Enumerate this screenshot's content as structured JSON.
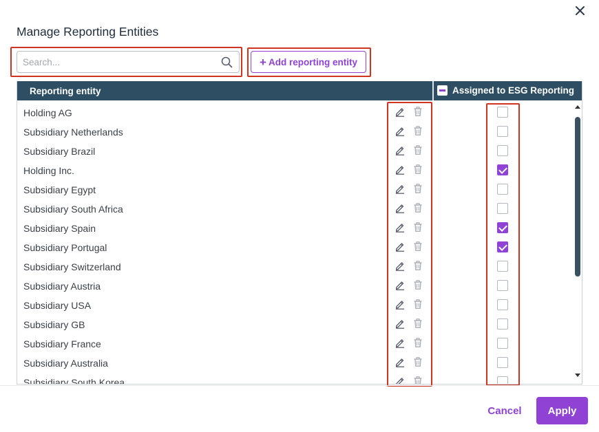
{
  "dialog": {
    "title": "Manage Reporting Entities",
    "close_icon": "close-icon"
  },
  "toolbar": {
    "search_placeholder": "Search...",
    "search_value": "",
    "search_icon": "search-icon",
    "add_label": "Add reporting entity",
    "add_icon": "plus-icon"
  },
  "table": {
    "columns": {
      "entity": "Reporting entity",
      "assigned": "Assigned to ESG Reporting"
    },
    "header_checkbox_state": "indeterminate",
    "row_icons": [
      "edit-icon",
      "delete-icon"
    ],
    "rows": [
      {
        "name": "Holding AG",
        "assigned": false
      },
      {
        "name": "Subsidiary Netherlands",
        "assigned": false
      },
      {
        "name": "Subsidiary Brazil",
        "assigned": false
      },
      {
        "name": "Holding Inc.",
        "assigned": true
      },
      {
        "name": "Subsidiary Egypt",
        "assigned": false
      },
      {
        "name": "Subsidiary South Africa",
        "assigned": false
      },
      {
        "name": "Subsidiary Spain",
        "assigned": true
      },
      {
        "name": "Subsidiary Portugal",
        "assigned": true
      },
      {
        "name": "Subsidiary Switzerland",
        "assigned": false
      },
      {
        "name": "Subsidiary Austria",
        "assigned": false
      },
      {
        "name": "Subsidiary USA",
        "assigned": false
      },
      {
        "name": "Subsidiary GB",
        "assigned": false
      },
      {
        "name": "Subsidiary France",
        "assigned": false
      },
      {
        "name": "Subsidiary Australia",
        "assigned": false
      },
      {
        "name": "Subsidiary South Korea",
        "assigned": false
      }
    ]
  },
  "footer": {
    "cancel_label": "Cancel",
    "apply_label": "Apply"
  },
  "colors": {
    "accent": "#8f42d4",
    "header_bg": "#2e4f63",
    "highlight": "#d0331f"
  }
}
